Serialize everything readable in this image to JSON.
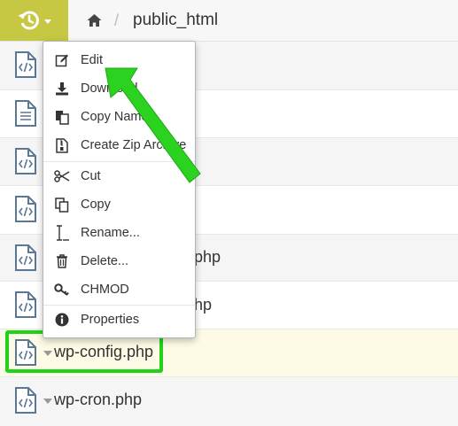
{
  "topbar": {
    "history_icon": "history-icon",
    "home_icon": "home-icon",
    "separator": "/",
    "current_folder": "public_html"
  },
  "files": [
    {
      "name": "",
      "icon": "code-file-icon"
    },
    {
      "name": "",
      "icon": "text-file-icon"
    },
    {
      "name": "",
      "icon": "code-file-icon"
    },
    {
      "name": "",
      "icon": "code-file-icon"
    },
    {
      "name": "php",
      "icon": "code-file-icon"
    },
    {
      "name": "hp",
      "icon": "code-file-icon"
    },
    {
      "name": "wp-config.php",
      "icon": "code-file-icon"
    },
    {
      "name": "wp-cron.php",
      "icon": "code-file-icon"
    }
  ],
  "context_menu": {
    "items": [
      {
        "label": "Edit",
        "icon": "edit-icon"
      },
      {
        "label": "Download",
        "icon": "download-icon"
      },
      {
        "label": "Copy Name",
        "icon": "copy-name-icon"
      },
      {
        "label": "Create Zip Archive",
        "icon": "zip-icon"
      },
      {
        "label": "Cut",
        "icon": "scissors-icon"
      },
      {
        "label": "Copy",
        "icon": "copy-icon"
      },
      {
        "label": "Rename...",
        "icon": "text-cursor-icon"
      },
      {
        "label": "Delete...",
        "icon": "trash-icon"
      },
      {
        "label": "CHMOD",
        "icon": "key-icon"
      },
      {
        "label": "Properties",
        "icon": "info-icon"
      }
    ]
  },
  "annotations": {
    "highlight_color": "#21d21b",
    "arrow_color": "#21d21b"
  },
  "colors": {
    "accent": "#c6c743",
    "row_alt": "#f5f5f5",
    "row_highlight": "#fdfbe5"
  }
}
